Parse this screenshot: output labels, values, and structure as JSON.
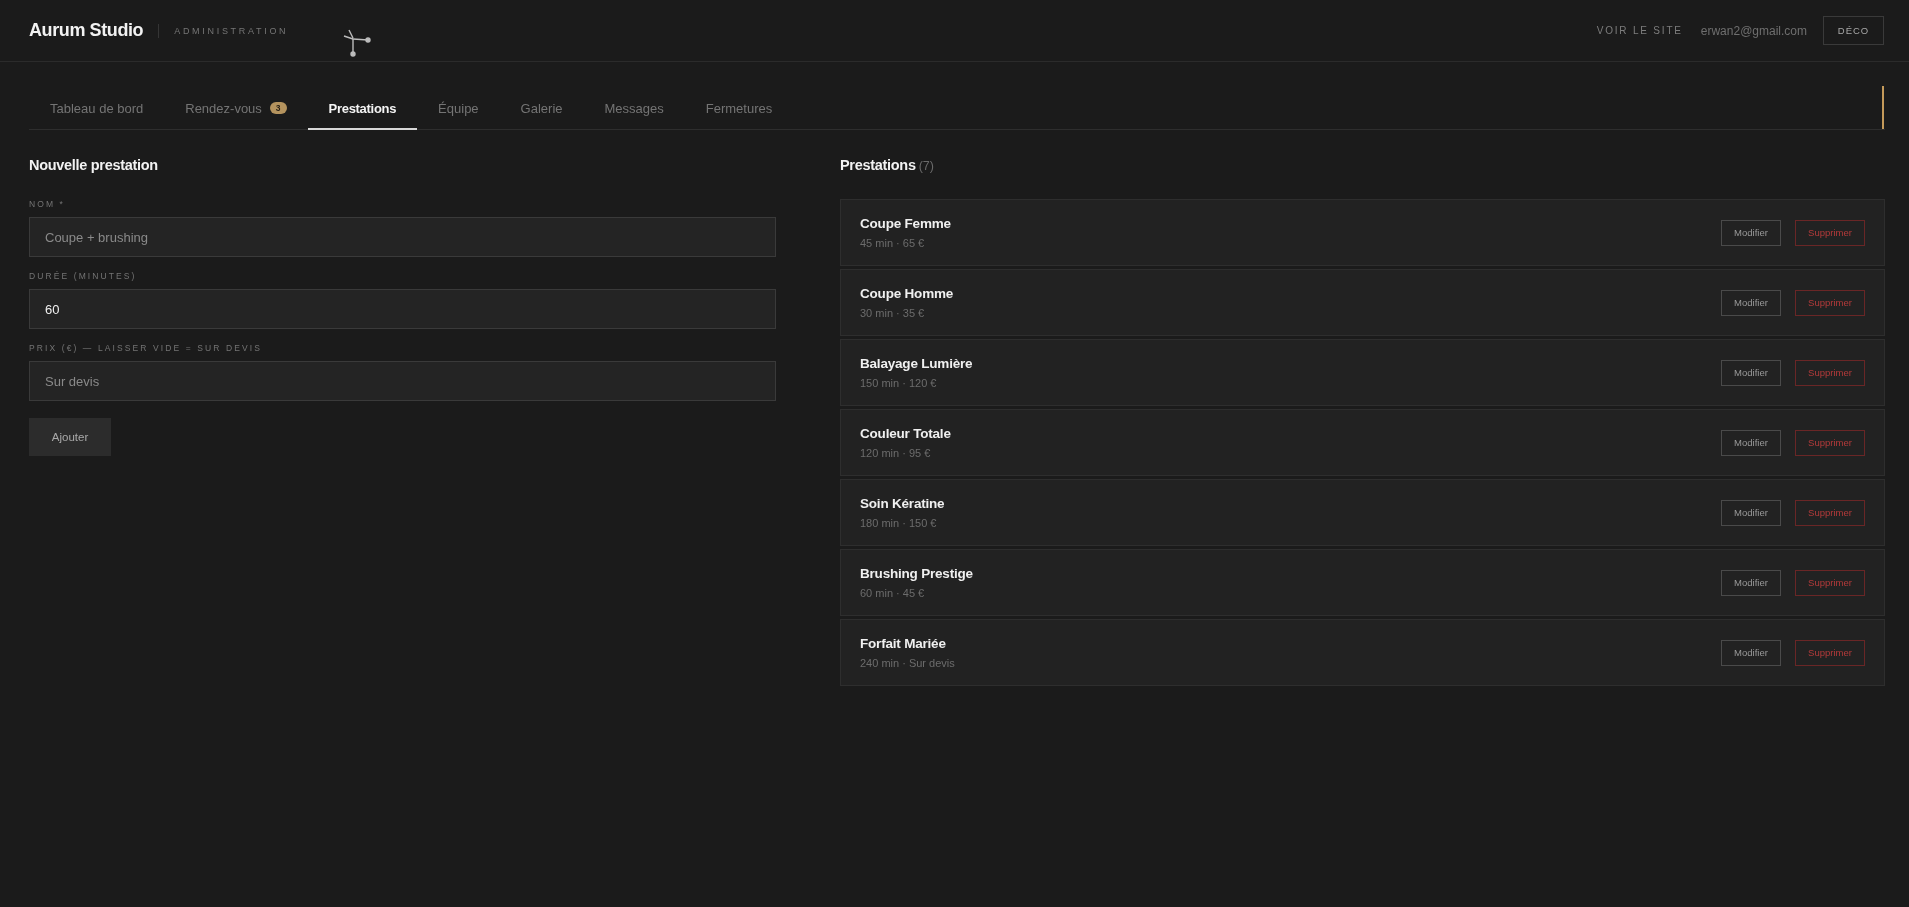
{
  "header": {
    "logo": "Aurum Studio",
    "subtitle": "ADMINISTRATION",
    "site_link": "VOIR LE SITE",
    "email": "erwan2@gmail.com",
    "logout_button": "DÉCO"
  },
  "tabs": [
    {
      "label": "Tableau de bord",
      "selected": false
    },
    {
      "label": "Rendez-vous",
      "selected": false,
      "badge": "3"
    },
    {
      "label": "Prestations",
      "selected": true
    },
    {
      "label": "Équipe",
      "selected": false
    },
    {
      "label": "Galerie",
      "selected": false
    },
    {
      "label": "Messages",
      "selected": false
    },
    {
      "label": "Fermetures",
      "selected": false
    }
  ],
  "form": {
    "title": "Nouvelle prestation",
    "fields": [
      {
        "label": "NOM *",
        "placeholder": "Coupe + brushing"
      },
      {
        "label": "DURÉE (MINUTES)",
        "value": "60"
      },
      {
        "label": "PRIX (€) — LAISSER VIDE = SUR DEVIS",
        "placeholder": "Sur devis"
      }
    ],
    "submit_button": "Ajouter"
  },
  "list": {
    "title": "Prestations",
    "count": "(7)",
    "items": [
      {
        "name": "Coupe Femme",
        "details": "45 min · 65 €",
        "edit_button": "Modifier",
        "delete_button": "Supprimer"
      },
      {
        "name": "Coupe Homme",
        "details": "30 min · 35 €",
        "edit_button": "Modifier",
        "delete_button": "Supprimer"
      },
      {
        "name": "Balayage Lumière",
        "details": "150 min · 120 €",
        "edit_button": "Modifier",
        "delete_button": "Supprimer"
      },
      {
        "name": "Couleur Totale",
        "details": "120 min · 95 €",
        "edit_button": "Modifier",
        "delete_button": "Supprimer"
      },
      {
        "name": "Soin Kératine",
        "details": "180 min · 150 €",
        "edit_button": "Modifier",
        "delete_button": "Supprimer"
      },
      {
        "name": "Brushing Prestige",
        "details": "60 min · 45 €",
        "edit_button": "Modifier",
        "delete_button": "Supprimer"
      },
      {
        "name": "Forfait Mariée",
        "details": "240 min · Sur devis",
        "edit_button": "Modifier",
        "delete_button": "Supprimer"
      }
    ]
  }
}
